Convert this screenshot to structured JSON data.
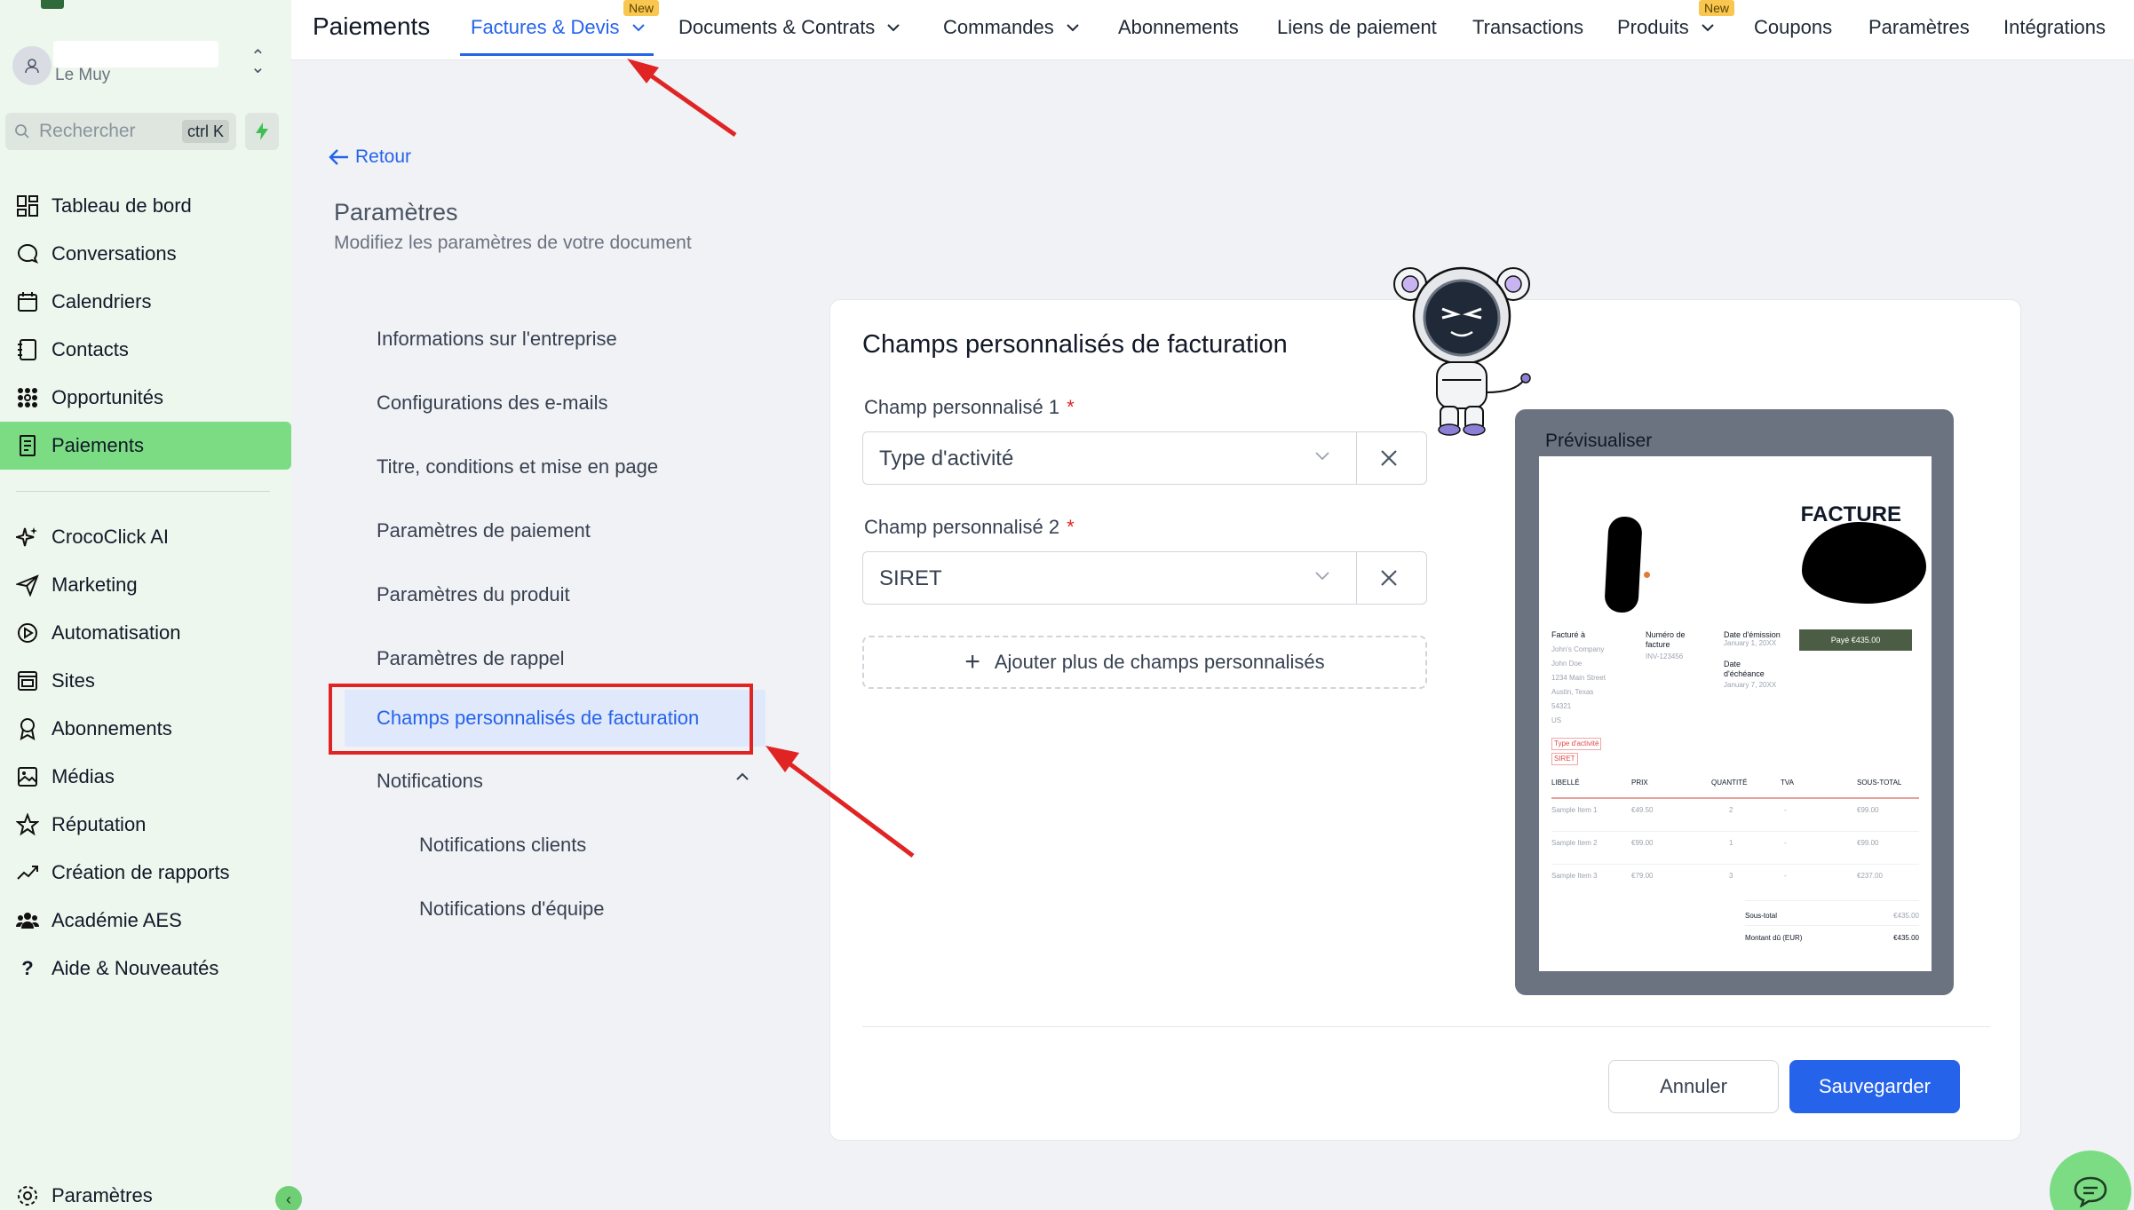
{
  "app": {
    "title": "Paiements"
  },
  "account": {
    "location": "Le Muy"
  },
  "search": {
    "placeholder": "Rechercher",
    "shortcut": "ctrl K"
  },
  "sidebar": {
    "items": [
      {
        "label": "Tableau de bord",
        "icon": "dashboard-icon"
      },
      {
        "label": "Conversations",
        "icon": "chat-icon"
      },
      {
        "label": "Calendriers",
        "icon": "calendar-icon"
      },
      {
        "label": "Contacts",
        "icon": "contacts-icon"
      },
      {
        "label": "Opportunités",
        "icon": "opportunities-icon"
      },
      {
        "label": "Paiements",
        "icon": "payments-icon",
        "active": true
      },
      {
        "label": "CrocoClick AI",
        "icon": "sparkle-icon"
      },
      {
        "label": "Marketing",
        "icon": "send-icon"
      },
      {
        "label": "Automatisation",
        "icon": "automation-icon"
      },
      {
        "label": "Sites",
        "icon": "sites-icon"
      },
      {
        "label": "Abonnements",
        "icon": "award-icon"
      },
      {
        "label": "Médias",
        "icon": "image-icon"
      },
      {
        "label": "Réputation",
        "icon": "star-icon"
      },
      {
        "label": "Création de rapports",
        "icon": "trend-icon"
      },
      {
        "label": "Académie AES",
        "icon": "users-icon"
      },
      {
        "label": "Aide & Nouveautés",
        "icon": "help-icon"
      }
    ],
    "settings_label": "Paramètres"
  },
  "topnav": {
    "tabs": [
      {
        "label": "Factures & Devis",
        "active": true,
        "badge": "New",
        "chevron": true
      },
      {
        "label": "Documents & Contrats",
        "chevron": true
      },
      {
        "label": "Commandes",
        "chevron": true
      },
      {
        "label": "Abonnements"
      },
      {
        "label": "Liens de paiement"
      },
      {
        "label": "Transactions"
      },
      {
        "label": "Produits",
        "badge": "New",
        "chevron": true
      },
      {
        "label": "Coupons"
      },
      {
        "label": "Paramètres"
      },
      {
        "label": "Intégrations"
      }
    ]
  },
  "page": {
    "back_label": "Retour",
    "title": "Paramètres",
    "subtitle": "Modifiez les paramètres de votre document"
  },
  "settings_menu": [
    {
      "label": "Informations sur l'entreprise"
    },
    {
      "label": "Configurations des e-mails"
    },
    {
      "label": "Titre, conditions et mise en page"
    },
    {
      "label": "Paramètres de paiement"
    },
    {
      "label": "Paramètres du produit"
    },
    {
      "label": "Paramètres de rappel"
    },
    {
      "label": "Champs personnalisés de facturation",
      "active": true
    },
    {
      "label": "Notifications",
      "expanded": true
    },
    {
      "label": "Notifications clients",
      "sub": true
    },
    {
      "label": "Notifications d'équipe",
      "sub": true
    }
  ],
  "form": {
    "title": "Champs personnalisés de facturation",
    "fields": [
      {
        "label": "Champ personnalisé 1",
        "required_mark": "*",
        "value": "Type d'activité"
      },
      {
        "label": "Champ personnalisé 2",
        "required_mark": "*",
        "value": "SIRET"
      }
    ],
    "add_more_label": "Ajouter plus de champs personnalisés",
    "cancel_label": "Annuler",
    "save_label": "Sauvegarder"
  },
  "preview": {
    "label": "Prévisualiser",
    "invoice_title": "FACTURE",
    "billed_to_label": "Facturé à",
    "billed_to_lines": [
      "John's Company",
      "John Doe",
      "1234 Main Street",
      "Austin, Texas",
      "54321",
      "US"
    ],
    "custom_field_1": "Type d'activité",
    "custom_field_2": "SIRET",
    "invoice_number_label": "Numéro de facture",
    "invoice_number": "INV-123456",
    "issue_date_label": "Date d'émission",
    "issue_date": "January 1, 20XX",
    "due_date_label": "Date d'échéance",
    "due_date": "January 7, 20XX",
    "paid_badge": "Payé €435.00",
    "columns": [
      "LIBELLÉ",
      "PRIX",
      "QUANTITÉ",
      "TVA",
      "SOUS-TOTAL"
    ],
    "rows": [
      {
        "item": "Sample Item 1",
        "price": "€49.50",
        "qty": "2",
        "tax": "-",
        "subtotal": "€99.00"
      },
      {
        "item": "Sample Item 2",
        "price": "€99.00",
        "qty": "1",
        "tax": "-",
        "subtotal": "€99.00"
      },
      {
        "item": "Sample Item 3",
        "price": "€79.00",
        "qty": "3",
        "tax": "-",
        "subtotal": "€237.00"
      }
    ],
    "subtotal_label": "Sous-total",
    "subtotal_value": "€435.00",
    "amount_due_label": "Montant dû (EUR)",
    "amount_due_value": "€435.00"
  },
  "colors": {
    "accent": "#2563eb",
    "sidebar_active": "#7bdc84",
    "annotation_red": "#e02424"
  }
}
